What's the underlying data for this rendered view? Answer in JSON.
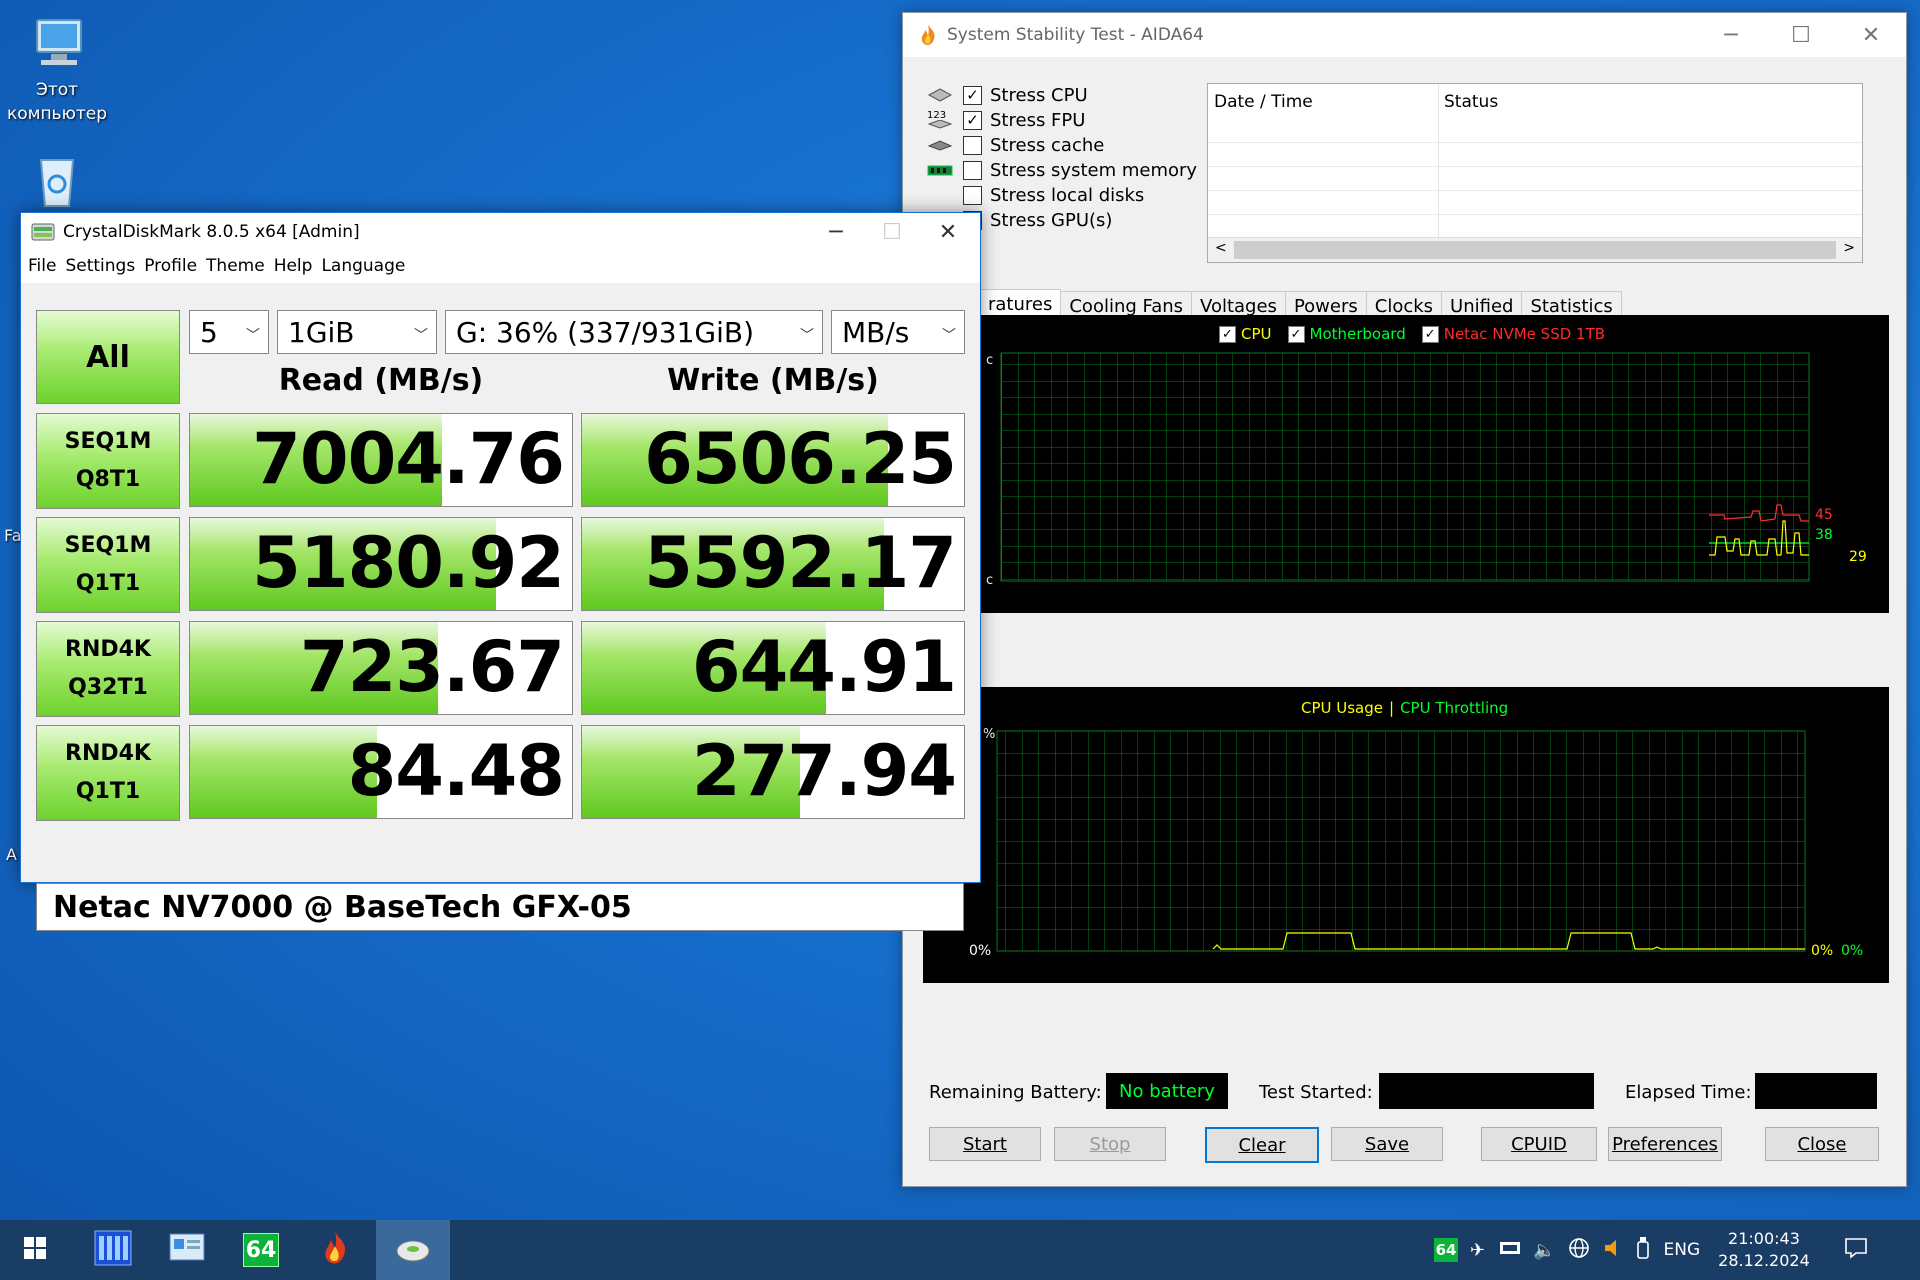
{
  "desktop": {
    "icons": [
      {
        "label_line1": "Этот",
        "label_line2": "компьютер"
      }
    ],
    "edge_fragments": [
      "Fa",
      "A"
    ]
  },
  "aida": {
    "title": "System Stability Test - AIDA64",
    "stress_items": [
      {
        "label": "Stress CPU",
        "checked": "✓"
      },
      {
        "label": "Stress FPU",
        "checked": "✓"
      },
      {
        "label": "Stress cache",
        "checked": ""
      },
      {
        "label": "Stress system memory",
        "checked": ""
      },
      {
        "label": "Stress local disks",
        "checked": ""
      },
      {
        "label": "Stress GPU(s)",
        "checked": ""
      }
    ],
    "fpu_icon_text": "123",
    "table_headers": [
      "Date / Time",
      "Status"
    ],
    "tabs": [
      "ratures",
      "Cooling Fans",
      "Voltages",
      "Powers",
      "Clocks",
      "Unified",
      "Statistics"
    ],
    "temp_graph": {
      "legend": [
        {
          "label": "CPU",
          "color": "#ffff00"
        },
        {
          "label": "Motherboard",
          "color": "#00ff30"
        },
        {
          "label": "Netac NVMe SSD 1TB",
          "color": "#ff2a2a"
        }
      ],
      "axis_top": "c",
      "axis_bottom": "c",
      "readouts": [
        {
          "value": "45",
          "color": "#ff3030"
        },
        {
          "value": "38",
          "color": "#00ff30"
        },
        {
          "value": "29",
          "color": "#ffff00"
        }
      ]
    },
    "usage_graph": {
      "legend_usage": "CPU Usage",
      "legend_sep": "|",
      "legend_throttle": "CPU Throttling",
      "usage_color": "#ffff00",
      "throttle_color": "#00ff30",
      "axis_top": "%",
      "axis_bottom": "0%",
      "readout_usage": "0%",
      "readout_throttle": "0%"
    },
    "battery_label": "Remaining Battery:",
    "battery_value": "No battery",
    "test_started_label": "Test Started:",
    "elapsed_label": "Elapsed Time:",
    "buttons": {
      "start": "Start",
      "stop": "Stop",
      "clear": "Clear",
      "save": "Save",
      "cpuid": "CPUID",
      "preferences": "Preferences",
      "close": "Close"
    }
  },
  "cdm": {
    "title": "CrystalDiskMark 8.0.5 x64 [Admin]",
    "menu": [
      "File",
      "Settings",
      "Profile",
      "Theme",
      "Help",
      "Language"
    ],
    "all_button": "All",
    "count": "5",
    "size": "1GiB",
    "drive": "G: 36% (337/931GiB)",
    "unit": "MB/s",
    "read_header": "Read (MB/s)",
    "write_header": "Write (MB/s)",
    "rows": [
      {
        "line1": "SEQ1M",
        "line2": "Q8T1",
        "read": "7004.76",
        "write": "6506.25",
        "read_fill": 0.66,
        "write_fill": 0.8
      },
      {
        "line1": "SEQ1M",
        "line2": "Q1T1",
        "read": "5180.92",
        "write": "5592.17",
        "read_fill": 0.8,
        "write_fill": 0.79
      },
      {
        "line1": "RND4K",
        "line2": "Q32T1",
        "read": "723.67",
        "write": "644.91",
        "read_fill": 0.65,
        "write_fill": 0.64
      },
      {
        "line1": "RND4K",
        "line2": "Q1T1",
        "read": "84.48",
        "write": "277.94",
        "read_fill": 0.49,
        "write_fill": 0.57
      }
    ],
    "drive_name": "Netac NV7000 @ BaseTech GFX-05"
  },
  "taskbar": {
    "aida_badge": "64",
    "tray_badge": "64",
    "language": "ENG",
    "time": "21:00:43",
    "date": "28.12.2024"
  }
}
